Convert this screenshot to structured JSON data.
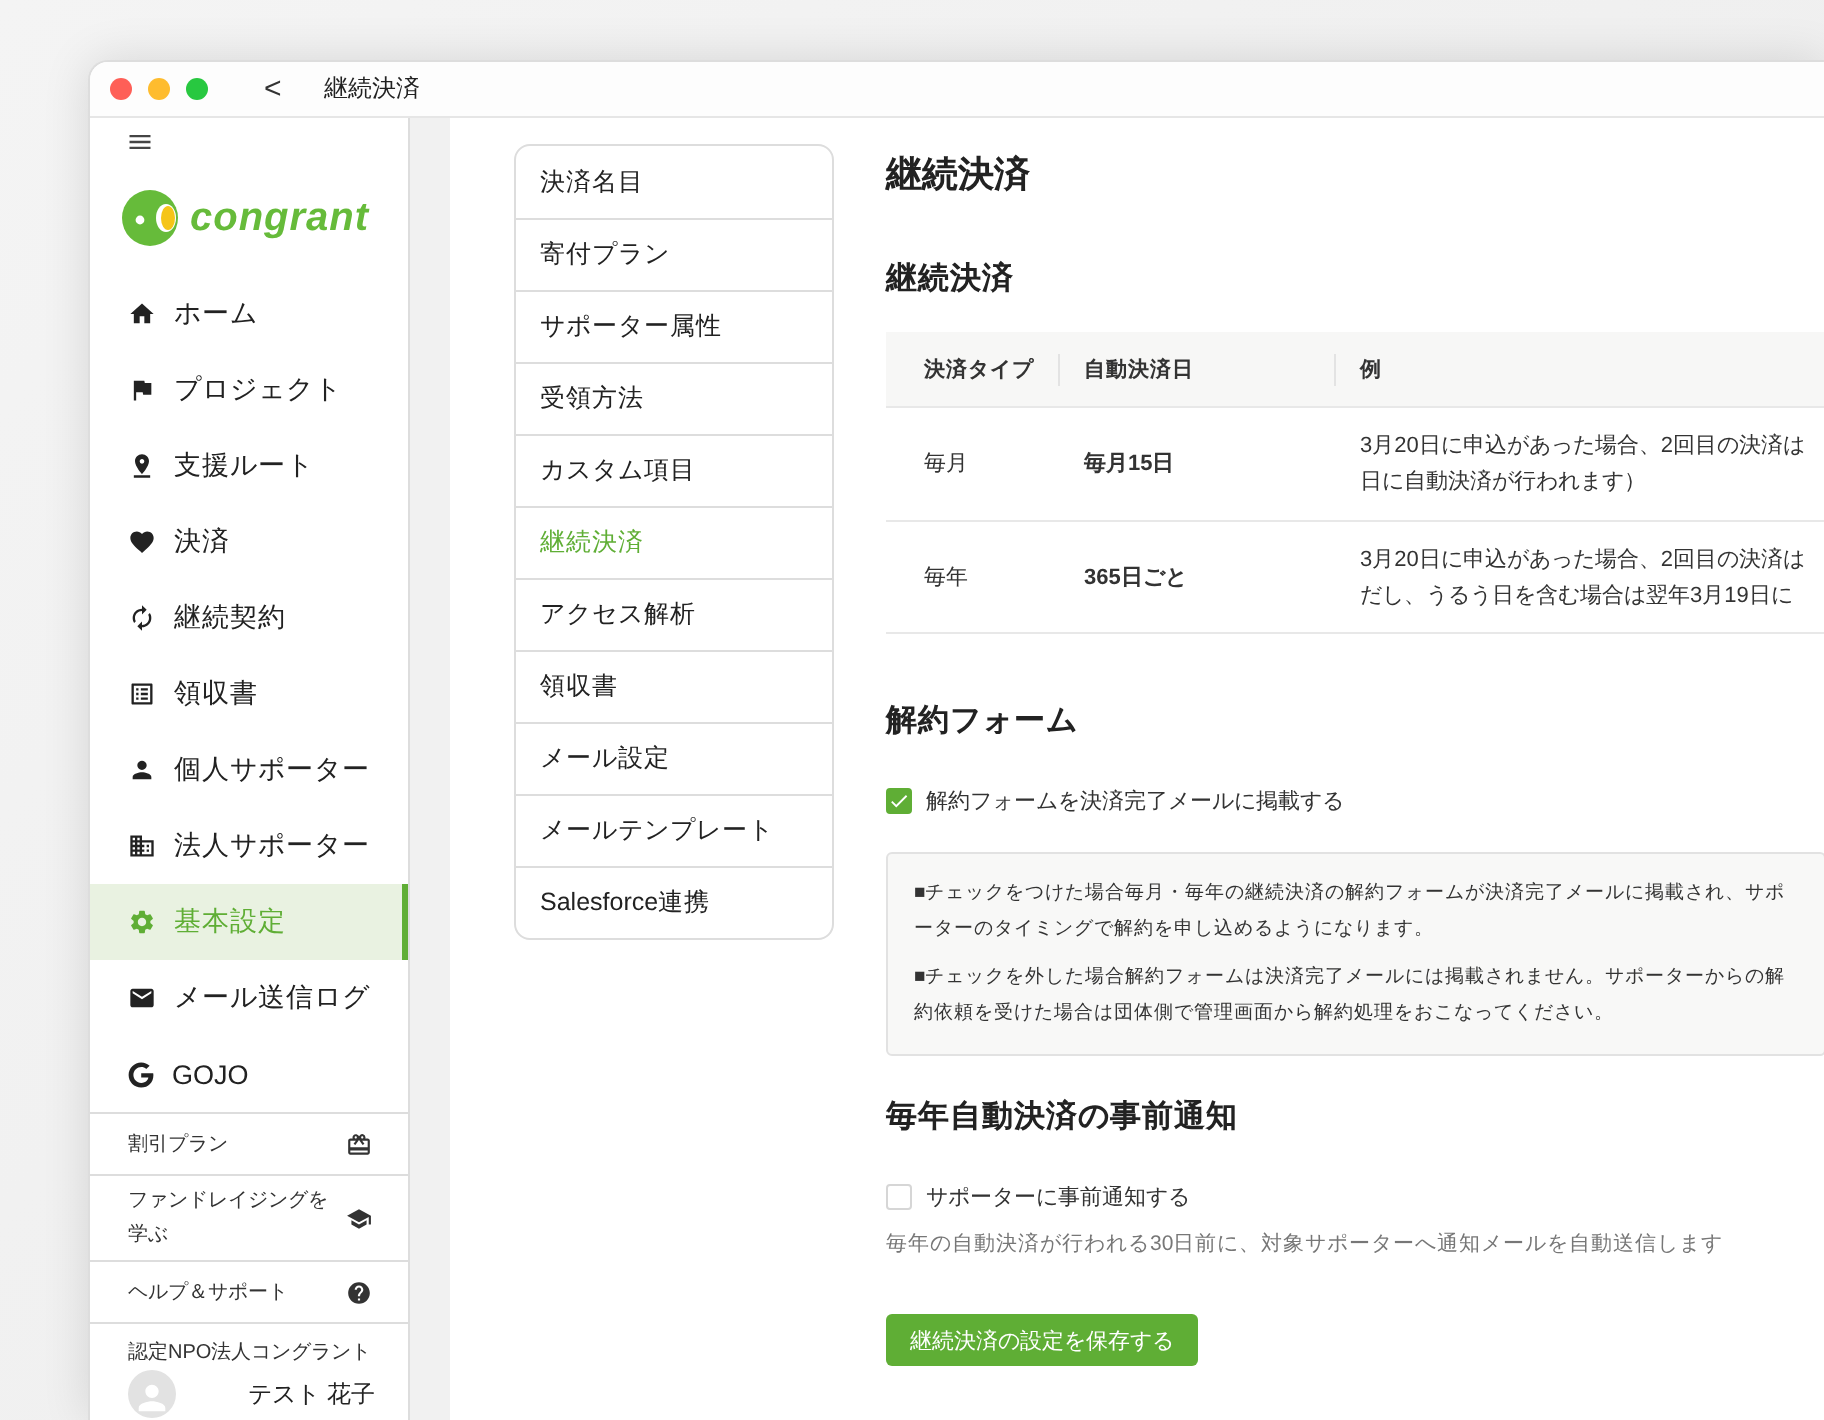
{
  "window": {
    "title": "継続決済",
    "back": "<"
  },
  "logo": {
    "text": "congrant"
  },
  "sidebar": {
    "items": [
      {
        "label": "ホーム",
        "selected": false
      },
      {
        "label": "プロジェクト",
        "selected": false
      },
      {
        "label": "支援ルート",
        "selected": false
      },
      {
        "label": "決済",
        "selected": false
      },
      {
        "label": "継続契約",
        "selected": false
      },
      {
        "label": "領収書",
        "selected": false
      },
      {
        "label": "個人サポーター",
        "selected": false
      },
      {
        "label": "法人サポーター",
        "selected": false
      },
      {
        "label": "基本設定",
        "selected": true
      },
      {
        "label": "メール送信ログ",
        "selected": false
      },
      {
        "label": "GOJO",
        "selected": false
      }
    ],
    "links": [
      "割引プラン",
      "ファンドレイジングを学ぶ",
      "ヘルプ＆サポート"
    ],
    "organization": "認定NPO法人コングラント",
    "user": "テスト 花子"
  },
  "settings_nav": {
    "items": [
      {
        "label": "決済名目",
        "selected": false
      },
      {
        "label": "寄付プラン",
        "selected": false
      },
      {
        "label": "サポーター属性",
        "selected": false
      },
      {
        "label": "受領方法",
        "selected": false
      },
      {
        "label": "カスタム項目",
        "selected": false
      },
      {
        "label": "継続決済",
        "selected": true
      },
      {
        "label": "アクセス解析",
        "selected": false
      },
      {
        "label": "領収書",
        "selected": false
      },
      {
        "label": "メール設定",
        "selected": false
      },
      {
        "label": "メールテンプレート",
        "selected": false
      },
      {
        "label": "Salesforce連携",
        "selected": false
      }
    ]
  },
  "page_title": "継続決済",
  "recurring": {
    "heading": "継続決済",
    "table": {
      "columns": [
        "決済タイプ",
        "自動決済日",
        "例"
      ],
      "rows": [
        {
          "type": "毎月",
          "date": "毎月15日",
          "example": [
            "3月20日に申込があった場合、2回目の決済は",
            "日に自動決済が行われます）"
          ]
        },
        {
          "type": "毎年",
          "date": "365日ごと",
          "example": [
            "3月20日に申込があった場合、2回目の決済は",
            "だし、うるう日を含む場合は翌年3月19日に"
          ]
        }
      ]
    }
  },
  "cancel_form": {
    "heading": "解約フォーム",
    "checkbox": {
      "label": "解約フォームを決済完了メールに掲載する",
      "checked": true
    },
    "notes": [
      "■チェックをつけた場合毎月・毎年の継続決済の解約フォームが決済完了メールに掲載され、サポーターのタイミングで解約を申し込めるようになります。",
      "■チェックを外した場合解約フォームは決済完了メールには掲載されません。サポーターからの解約依頼を受けた場合は団体側で管理画面から解約処理をおこなってください。"
    ]
  },
  "advance_notice": {
    "heading": "毎年自動決済の事前通知",
    "checkbox": {
      "label": "サポーターに事前通知する",
      "checked": false
    },
    "description": "毎年の自動決済が行われる30日前に、対象サポーターへ通知メールを自動送信します"
  },
  "save_button": "継続決済の設定を保存する"
}
